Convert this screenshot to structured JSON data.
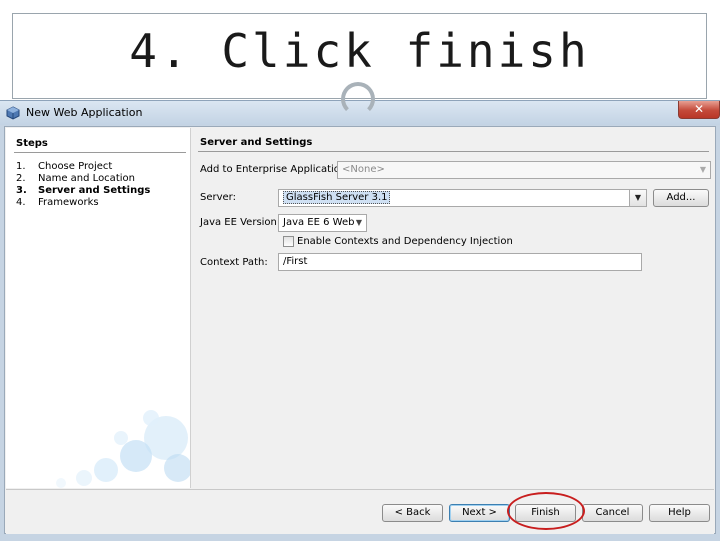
{
  "slide": {
    "title": "4.  Click finish"
  },
  "dialog": {
    "title": "New Web Application",
    "close_label": "✕",
    "steps": {
      "heading": "Steps",
      "items": [
        {
          "num": "1.",
          "label": "Choose Project"
        },
        {
          "num": "2.",
          "label": "Name and Location"
        },
        {
          "num": "3.",
          "label": "Server and Settings"
        },
        {
          "num": "4.",
          "label": "Frameworks"
        }
      ],
      "current_index": 2
    },
    "panel": {
      "heading": "Server and Settings",
      "enterprise_label": "Add to Enterprise Application:",
      "enterprise_value": "<None>",
      "server_label": "Server:",
      "server_value": "GlassFish Server 3.1",
      "add_button": "Add...",
      "javaee_label": "Java EE Version:",
      "javaee_value": "Java EE 6 Web",
      "cdi_label": "Enable Contexts and Dependency Injection",
      "cdi_checked": false,
      "context_label": "Context Path:",
      "context_value": "/First"
    },
    "buttons": {
      "back": "< Back",
      "next": "Next >",
      "finish": "Finish",
      "cancel": "Cancel",
      "help": "Help"
    }
  },
  "icons": {
    "app": "netbeans-cube-icon",
    "dropdown": "chevron-down-icon",
    "close": "close-icon"
  },
  "colors": {
    "highlight": "#c81e1e",
    "window_frame": "#c6d4e3",
    "close_button": "#c44a3a"
  }
}
